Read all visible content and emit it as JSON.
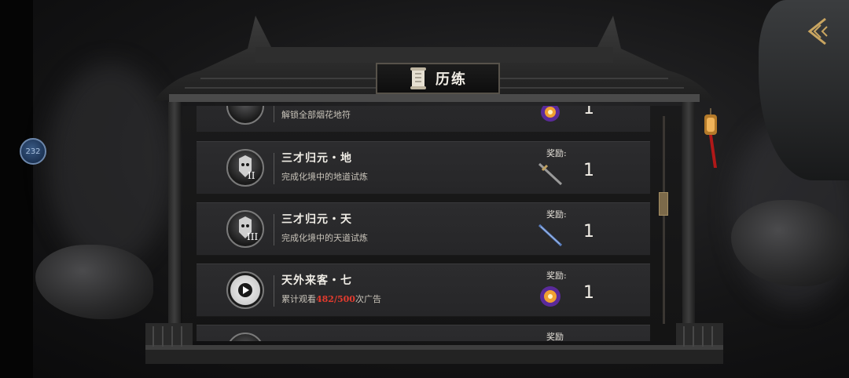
{
  "counter_badge": {
    "value": "232"
  },
  "header": {
    "title": "历练"
  },
  "rows": [
    {
      "title": "",
      "desc": "解锁全部烟花地符",
      "reward_label": "",
      "reward_icon": "orb-icon",
      "reward_count": "1"
    },
    {
      "title": "三才归元・地",
      "desc": "完成化境中的地道试炼",
      "reward_label": "奖励:",
      "reward_icon": "sword-icon",
      "reward_count": "1",
      "rank": "II"
    },
    {
      "title": "三才归元・天",
      "desc": "完成化境中的天道试炼",
      "reward_label": "奖励:",
      "reward_icon": "blue-sword-icon",
      "reward_count": "1",
      "rank": "III"
    },
    {
      "title": "天外来客・七",
      "desc_prefix": "累计观看",
      "desc_highlight": "482/500",
      "desc_suffix": "次广告",
      "reward_label": "奖励:",
      "reward_icon": "orb-icon",
      "reward_count": "1"
    },
    {
      "title": "",
      "desc": "",
      "reward_label": "奖励",
      "reward_count": ""
    }
  ],
  "colors": {
    "highlight": "#e33b2e",
    "frame": "#2e2e2e",
    "panel": "#1a1a1b"
  }
}
